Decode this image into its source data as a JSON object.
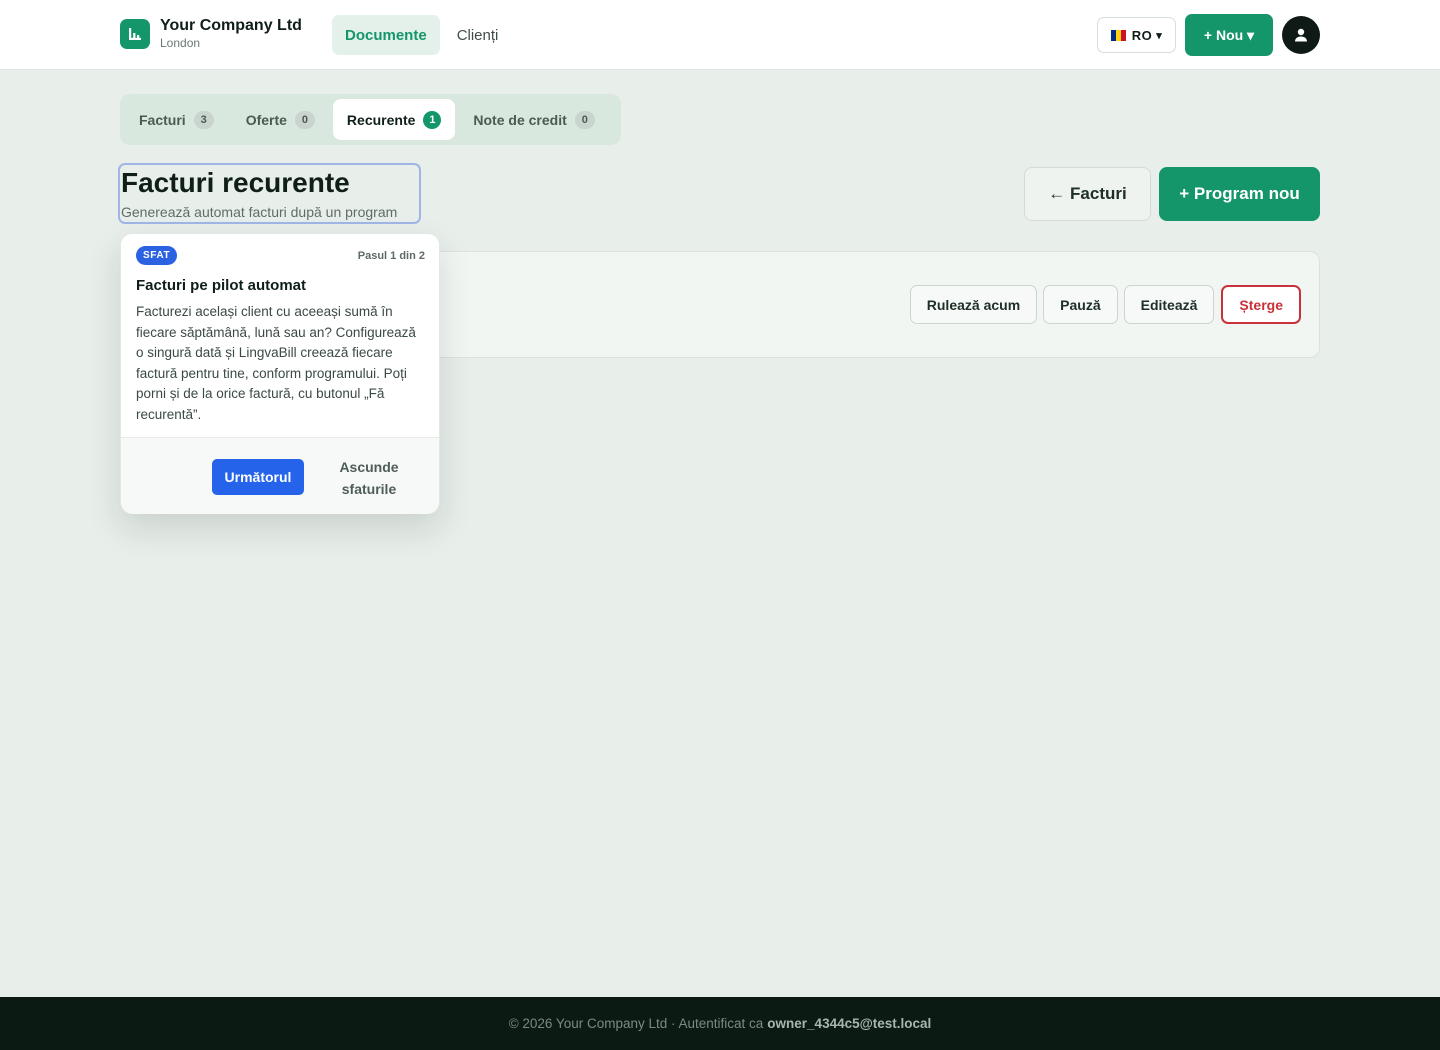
{
  "brand": {
    "name": "Your Company Ltd",
    "city": "London"
  },
  "nav": {
    "items": [
      {
        "label": "Documente"
      },
      {
        "label": "Clienți"
      }
    ]
  },
  "lang": {
    "code": "RO",
    "chevron": "▾",
    "flag_colors": [
      "#002b7f",
      "#fcd116",
      "#ce1126"
    ]
  },
  "header": {
    "new_label": "+ Nou ▾"
  },
  "tabs": [
    {
      "label": "Facturi",
      "count": "3"
    },
    {
      "label": "Oferte",
      "count": "0"
    },
    {
      "label": "Recurente",
      "count": "1"
    },
    {
      "label": "Note de credit",
      "count": "0"
    }
  ],
  "page": {
    "title": "Facturi recurente",
    "subtitle": "Generează automat facturi după un program",
    "back_label": "← Facturi",
    "program_label": "+ Program nou"
  },
  "card": {
    "actions": [
      {
        "label": "Rulează acum"
      },
      {
        "label": "Pauză"
      },
      {
        "label": "Editează"
      },
      {
        "label": "Șterge"
      }
    ]
  },
  "tip": {
    "badge": "SFAT",
    "step": "Pasul 1 din 2",
    "title": "Facturi pe pilot automat",
    "body": "Facturezi același client cu aceeași sumă în fiecare săptămână, lună sau an? Configurează o singură dată și LingvaBill creează fiecare factură pentru tine, conform programului. Poți porni și de la orice factură, cu butonul „Fă recurentă”.",
    "next_label": "Următorul",
    "hide_label": "Ascunde sfaturile"
  },
  "footer": {
    "text": "© 2026 Your Company Ltd · Autentificat ca",
    "user": "owner_4344c5@test.local"
  },
  "colors": {
    "accent": "#14956a",
    "primary_blue": "#2563eb",
    "danger": "#c8323a",
    "footer_bg": "#0c1a14"
  }
}
